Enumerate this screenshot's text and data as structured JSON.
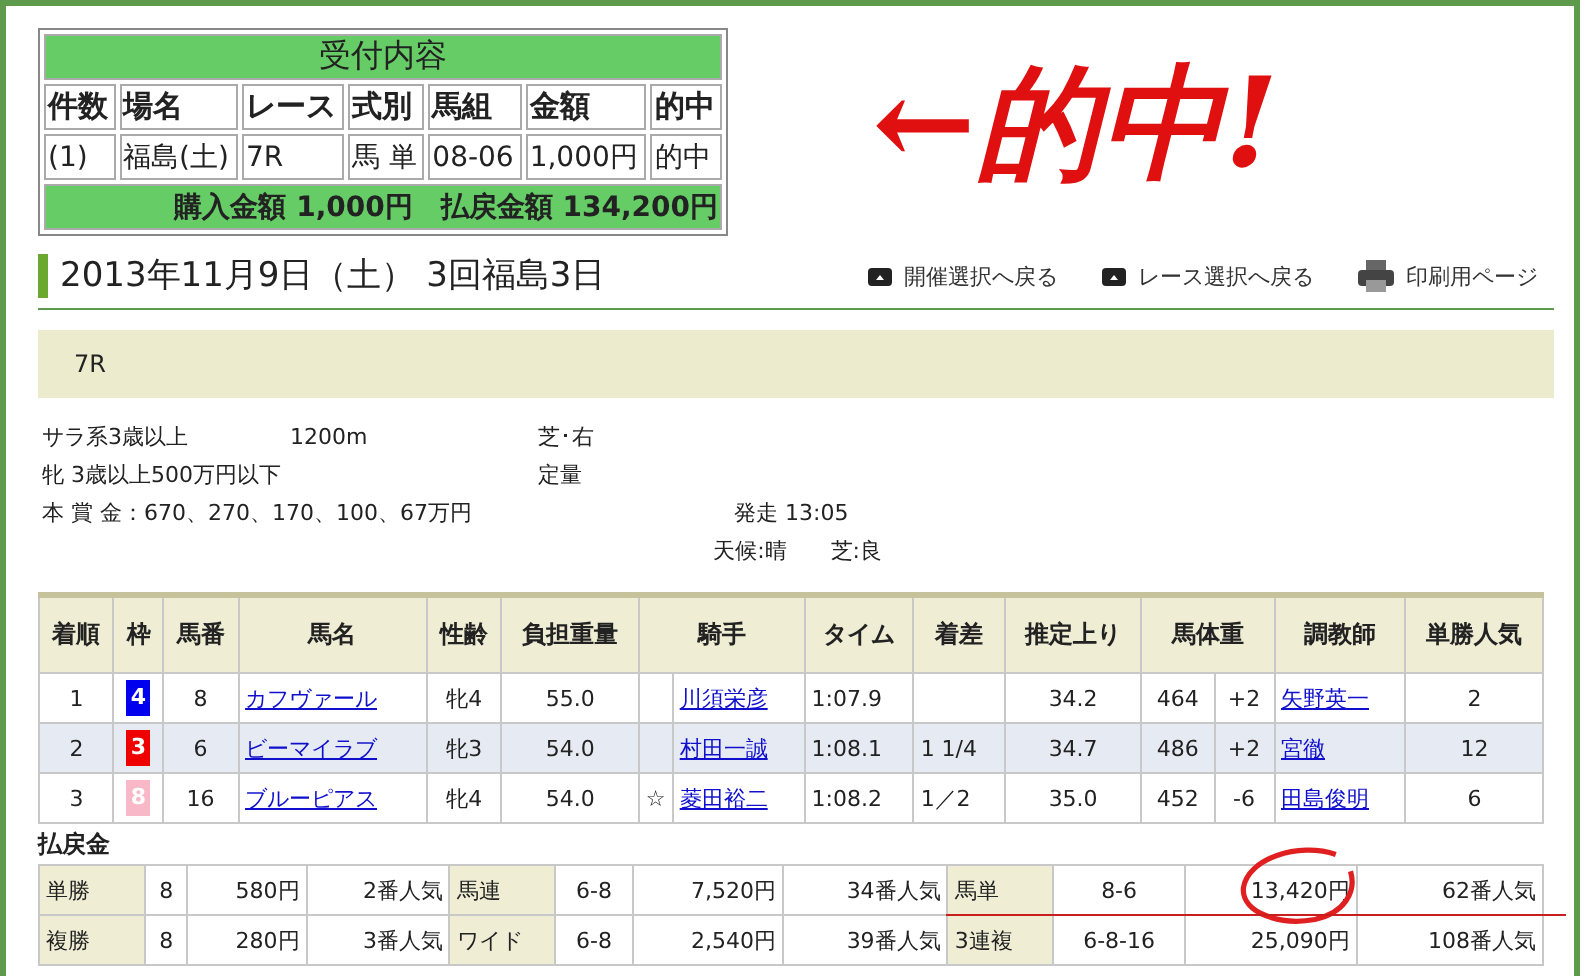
{
  "ticket": {
    "title": "受付内容",
    "columns": [
      "件数",
      "場名",
      "レース",
      "式別",
      "馬組",
      "金額",
      "的中"
    ],
    "row": [
      "(1)",
      "福島(土)",
      "7R",
      "馬 単",
      "08-06",
      "1,000円",
      "的中"
    ],
    "summary": "購入金額 1,000円　払戻金額 134,200円"
  },
  "banner": "←的中!",
  "race_title": "2013年11月9日（土） 3回福島3日",
  "links": [
    {
      "label": "開催選択へ戻る",
      "kind": "back"
    },
    {
      "label": "レース選択へ戻る",
      "kind": "back"
    },
    {
      "label": "印刷用ページ",
      "kind": "print"
    }
  ],
  "race_number": "7R",
  "info": {
    "class": "サラ系3歳以上",
    "distance": "1200m",
    "surface": "芝･右",
    "condition": "牝 3歳以上500万円以下",
    "weight_rule": "定量",
    "prize": "本 賞 金：670、270、170、100、67万円",
    "start": "発走 13:05",
    "weather": "天候:晴",
    "going": "芝:良"
  },
  "results": {
    "columns": [
      "着順",
      "枠",
      "馬番",
      "馬名",
      "性齢",
      "負担重量",
      "騎手",
      "タイム",
      "着差",
      "推定上り",
      "馬体重",
      "調教師",
      "単勝人気"
    ],
    "rows": [
      {
        "place": "1",
        "frame": "4",
        "color": "#0000ee",
        "number": "8",
        "horse": "カフヴァール",
        "sex_age": "牝4",
        "weight": "55.0",
        "mark": "",
        "jockey": "川須栄彦",
        "time": "1:07.9",
        "margin": "",
        "last3f": "34.2",
        "body": "464",
        "diff": "+2",
        "trainer": "矢野英一",
        "pop": "2"
      },
      {
        "place": "2",
        "frame": "3",
        "color": "#ee0000",
        "number": "6",
        "horse": "ビーマイラブ",
        "sex_age": "牝3",
        "weight": "54.0",
        "mark": "",
        "jockey": "村田一誠",
        "time": "1:08.1",
        "margin": "1 1/4",
        "last3f": "34.7",
        "body": "486",
        "diff": "+2",
        "trainer": "宮徹",
        "pop": "12"
      },
      {
        "place": "3",
        "frame": "8",
        "color": "#f8b8c8",
        "number": "16",
        "horse": "ブルーピアス",
        "sex_age": "牝4",
        "weight": "54.0",
        "mark": "☆",
        "jockey": "菱田裕二",
        "time": "1:08.2",
        "margin": "1／2",
        "last3f": "35.0",
        "body": "452",
        "diff": "-6",
        "trainer": "田島俊明",
        "pop": "6"
      }
    ]
  },
  "payout": {
    "title": "払戻金",
    "rows": [
      [
        {
          "type": "単勝",
          "combo": "8",
          "amount": "580円",
          "pop": "2番人気",
          "circled": false
        },
        {
          "type": "馬連",
          "combo": "6-8",
          "amount": "7,520円",
          "pop": "34番人気",
          "circled": false
        },
        {
          "type": "馬単",
          "combo": "8-6",
          "amount": "13,420円",
          "pop": "62番人気",
          "circled": true
        }
      ],
      [
        {
          "type": "複勝",
          "combo": "8",
          "amount": "280円",
          "pop": "3番人気",
          "circled": false
        },
        {
          "type": "ワイド",
          "combo": "6-8",
          "amount": "2,540円",
          "pop": "39番人気",
          "circled": false
        },
        {
          "type": "3連複",
          "combo": "6-8-16",
          "amount": "25,090円",
          "pop": "108番人気",
          "circled": false
        }
      ]
    ]
  }
}
